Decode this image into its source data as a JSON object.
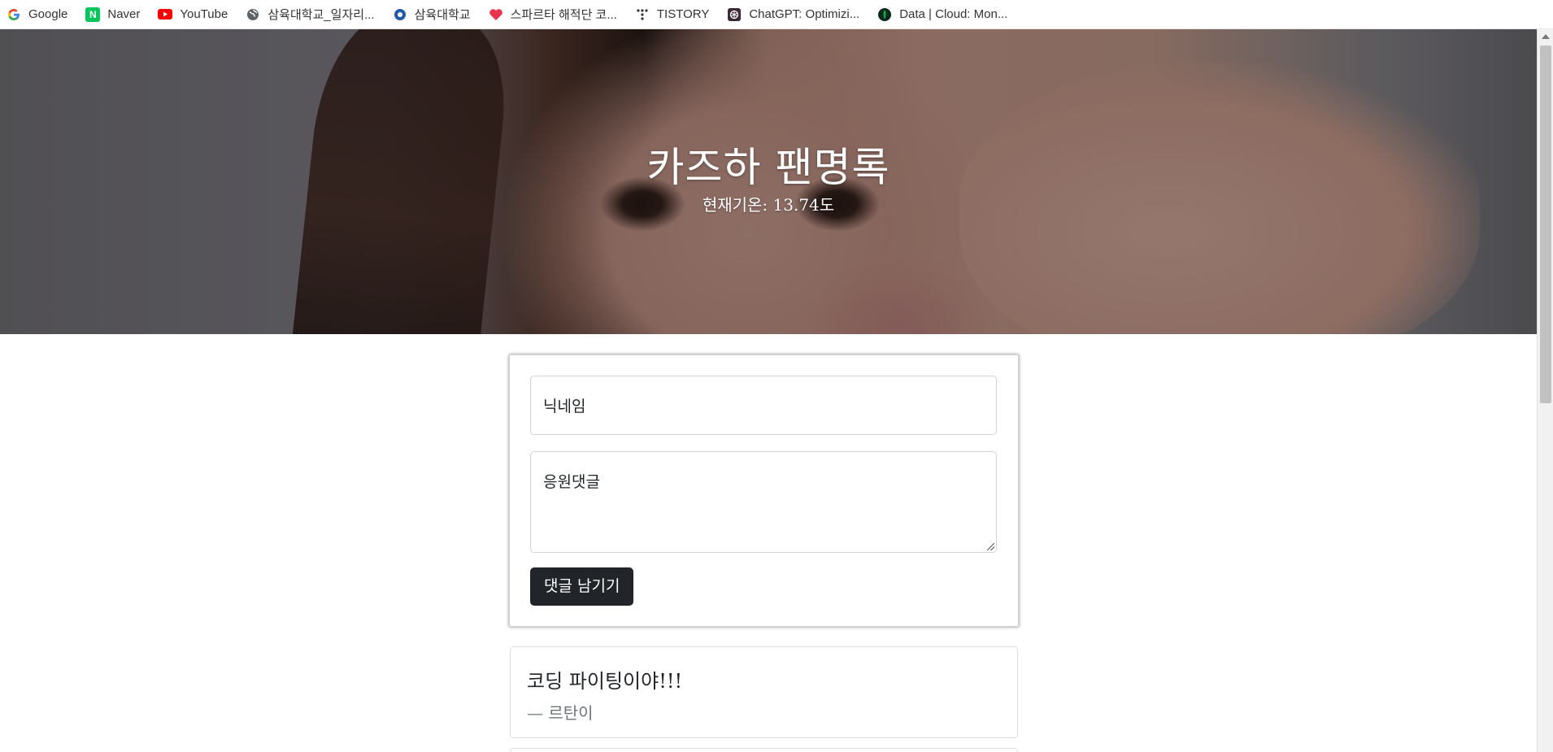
{
  "bookmarks": [
    {
      "label": "Google",
      "icon": "google-icon"
    },
    {
      "label": "Naver",
      "icon": "naver-icon"
    },
    {
      "label": "YouTube",
      "icon": "youtube-icon"
    },
    {
      "label": "삼육대학교_일자리...",
      "icon": "globe-icon"
    },
    {
      "label": "삼육대학교",
      "icon": "university-icon"
    },
    {
      "label": "스파르타 해적단 코...",
      "icon": "sparta-icon"
    },
    {
      "label": "TISTORY",
      "icon": "tistory-icon"
    },
    {
      "label": "ChatGPT: Optimizi...",
      "icon": "chatgpt-icon"
    },
    {
      "label": "Data | Cloud: Mon...",
      "icon": "mongodb-icon"
    }
  ],
  "hero": {
    "title": "카즈하 팬명록",
    "temperature": "현재기온: 13.74도"
  },
  "form": {
    "nickname_placeholder": "닉네임",
    "comment_placeholder": "응원댓글",
    "submit_label": "댓글 남기기"
  },
  "comments": [
    {
      "text": "코딩 파이팅이야!!!",
      "author": "— 르탄이"
    }
  ],
  "colors": {
    "button_bg": "#212529",
    "author_text": "#6c757d",
    "youtube_red": "#ff0000",
    "naver_green": "#03c75a"
  }
}
